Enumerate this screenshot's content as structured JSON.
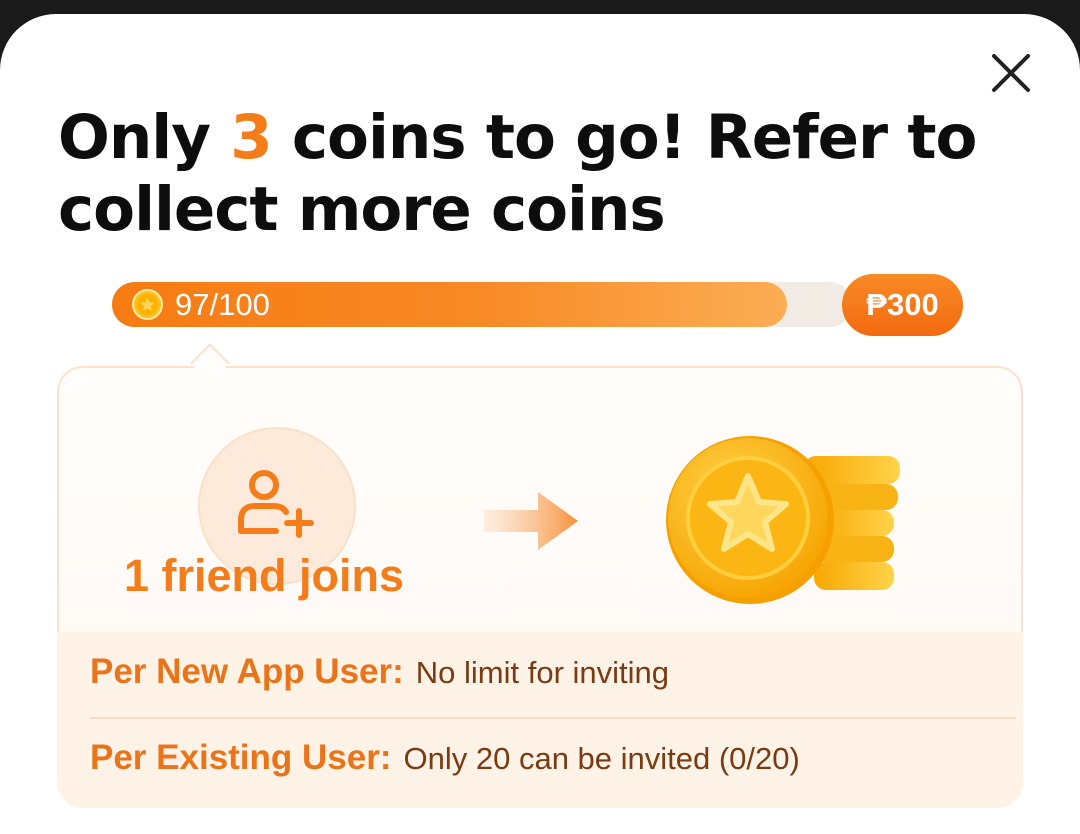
{
  "headline": {
    "part1": "Only ",
    "accent": "3",
    "part2": " coins to go! Refer to collect more coins"
  },
  "progress": {
    "text": "97/100",
    "current": 97,
    "total": 100,
    "reward": "₱300"
  },
  "card": {
    "friend_label": "1 friend joins"
  },
  "rules": [
    {
      "key": "Per New App User:",
      "value": "No limit for inviting"
    },
    {
      "key": "Per Existing User:",
      "value": "Only 20 can be invited (0/20)"
    }
  ],
  "colors": {
    "accent": "#f47d1a",
    "progress_start": "#f67b12",
    "progress_end": "#fbae55",
    "rules_bg": "#fff2e6"
  },
  "icons": {
    "close": "close-icon",
    "progress_coin": "coin-icon",
    "friend": "add-friend-icon",
    "arrow": "arrow-right-icon",
    "reward_visual": "coin-stack-icon"
  }
}
